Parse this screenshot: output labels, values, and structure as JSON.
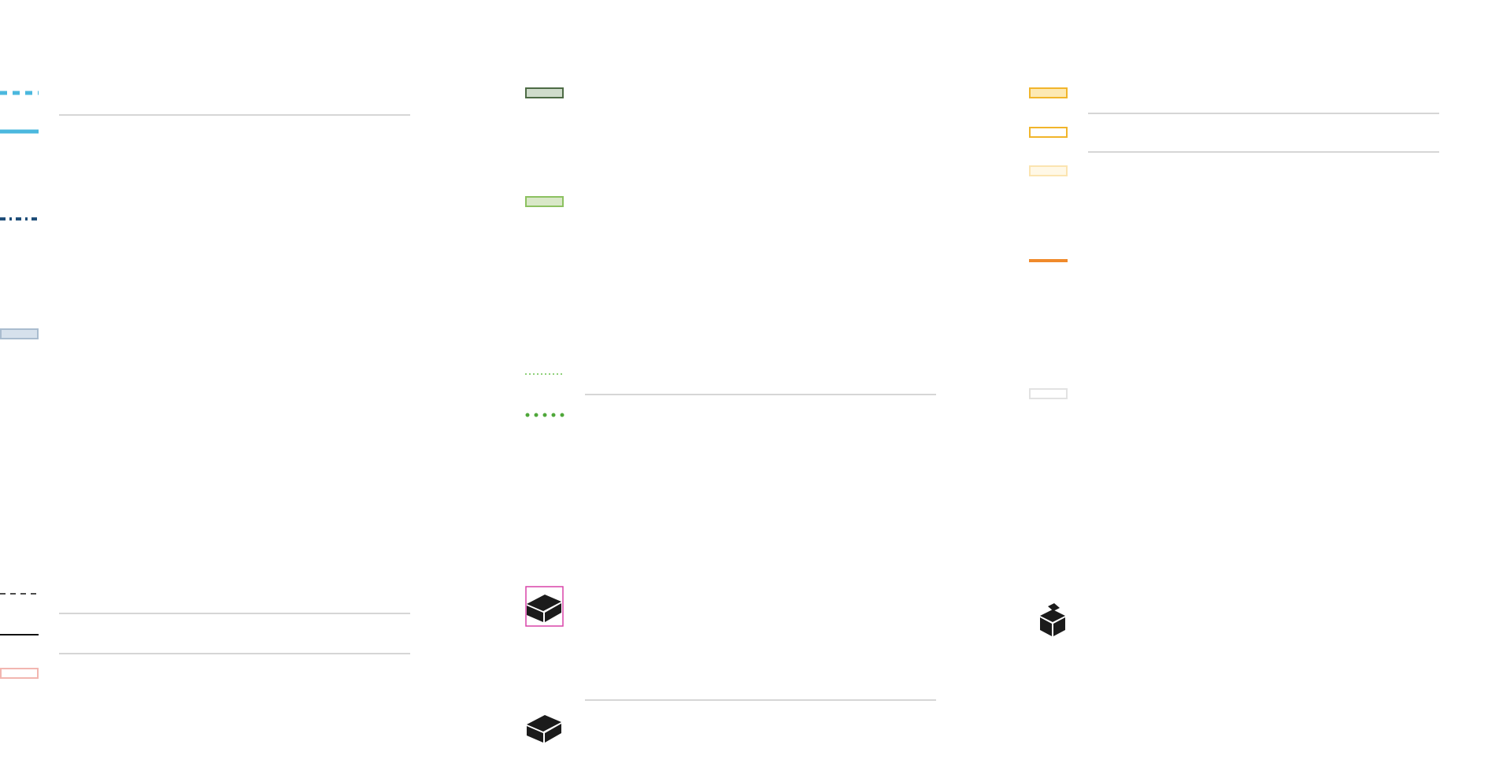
{
  "colors": {
    "cyan": "#4bb8de",
    "navy": "#1f4e79",
    "steel_fill": "#d6e1ec",
    "steel_stroke": "#a9bccf",
    "black": "#111111",
    "salmon": "#f2b6b0",
    "dark_green_fill": "#cfdccb",
    "dark_green_stroke": "#4d6b45",
    "light_green_fill": "#d9e8c8",
    "light_green_stroke": "#8cc160",
    "dotted_green_light": "#8fd17a",
    "dotted_green": "#4fa83a",
    "magenta": "#d944a8",
    "box_fill": "#1b1b1b",
    "gold_fill": "#fde9b3",
    "gold_stroke": "#f1b52b",
    "gold_pale_fill": "#fff8e6",
    "gold_pale_stroke": "#fbe4b0",
    "orange": "#f08a2b",
    "pale_gray": "#e2e2e2",
    "rule": "#c8c8c8"
  },
  "legend": {
    "column_1": [
      {
        "name": "cyan-dashed-line-icon",
        "symbol": "line",
        "style": "dashed-thick",
        "color": "cyan"
      },
      {
        "name": "cyan-solid-line-icon",
        "symbol": "line",
        "style": "solid-thick",
        "color": "cyan"
      },
      {
        "name": "navy-dotted-line-icon",
        "symbol": "line",
        "style": "dash-dot",
        "color": "navy"
      },
      {
        "name": "steel-filled-rectangle-icon",
        "symbol": "rect",
        "fill": "steel_fill",
        "stroke": "steel_stroke"
      },
      {
        "name": "black-dashed-line-icon",
        "symbol": "line",
        "style": "dashed-thin",
        "color": "black"
      },
      {
        "name": "black-solid-line-icon",
        "symbol": "line",
        "style": "solid-thin",
        "color": "black"
      },
      {
        "name": "salmon-outline-rectangle-icon",
        "symbol": "rect",
        "fill": "none",
        "stroke": "salmon"
      }
    ],
    "column_2": [
      {
        "name": "dark-green-rectangle-icon",
        "symbol": "rect",
        "fill": "dark_green_fill",
        "stroke": "dark_green_stroke"
      },
      {
        "name": "light-green-rectangle-icon",
        "symbol": "rect",
        "fill": "light_green_fill",
        "stroke": "light_green_stroke"
      },
      {
        "name": "light-green-fine-dotted-line-icon",
        "symbol": "line",
        "style": "fine-dots",
        "color": "dotted_green_light"
      },
      {
        "name": "green-dotted-line-icon",
        "symbol": "line",
        "style": "round-dots",
        "color": "dotted_green"
      },
      {
        "name": "box-in-magenta-frame-icon",
        "symbol": "box",
        "frame": "magenta"
      },
      {
        "name": "box-icon",
        "symbol": "box"
      }
    ],
    "column_3": [
      {
        "name": "gold-filled-rectangle-icon",
        "symbol": "rect",
        "fill": "gold_fill",
        "stroke": "gold_stroke"
      },
      {
        "name": "gold-outline-rectangle-icon",
        "symbol": "rect",
        "fill": "none",
        "stroke": "gold_stroke"
      },
      {
        "name": "pale-gold-rectangle-icon",
        "symbol": "rect",
        "fill": "gold_pale_fill",
        "stroke": "gold_pale_stroke"
      },
      {
        "name": "orange-line-icon",
        "symbol": "line",
        "style": "solid-medium",
        "color": "orange"
      },
      {
        "name": "pale-gray-rectangle-icon",
        "symbol": "rect",
        "fill": "none",
        "stroke": "pale_gray"
      },
      {
        "name": "cube-icon",
        "symbol": "cube"
      }
    ]
  }
}
